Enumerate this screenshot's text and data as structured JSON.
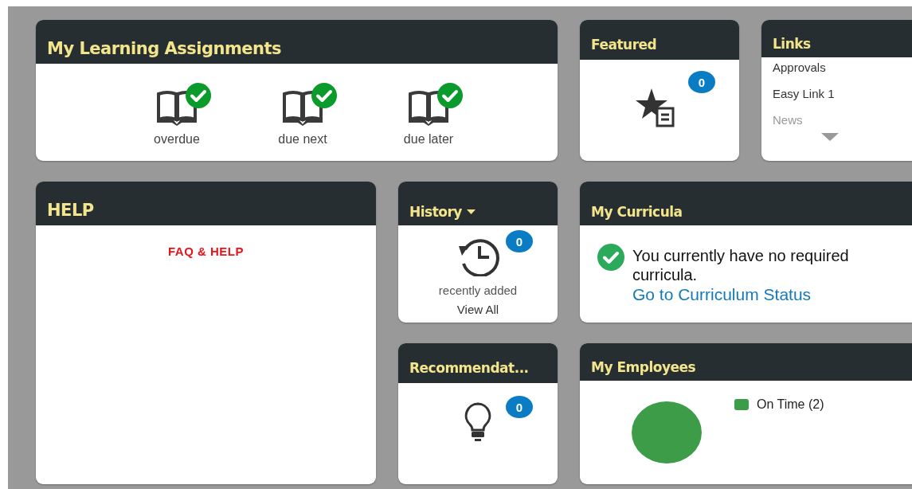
{
  "learning": {
    "title": "My Learning Assignments",
    "items": [
      {
        "label": "overdue",
        "complete": true
      },
      {
        "label": "due next",
        "complete": true
      },
      {
        "label": "due later",
        "complete": true
      }
    ]
  },
  "featured": {
    "title": "Featured",
    "count": "0"
  },
  "links": {
    "title": "Links",
    "items": [
      {
        "label": "Approvals",
        "faded": false
      },
      {
        "label": "Easy Link 1",
        "faded": false
      },
      {
        "label": "News",
        "faded": true
      }
    ],
    "more_below": true
  },
  "help": {
    "title": "HELP",
    "link": "FAQ & HELP"
  },
  "history": {
    "title": "History",
    "dropdown": true,
    "count": "0",
    "caption": "recently added",
    "action": "View All"
  },
  "curricula": {
    "title": "My Curricula",
    "message": "You currently have no required curricula.",
    "link": "Go to Curriculum Status"
  },
  "recommendations": {
    "title": "Recommendat...",
    "count": "0"
  },
  "employees": {
    "title": "My Employees",
    "legend": [
      {
        "label": "On Time (2)",
        "color": "#3d9c47"
      }
    ]
  }
}
